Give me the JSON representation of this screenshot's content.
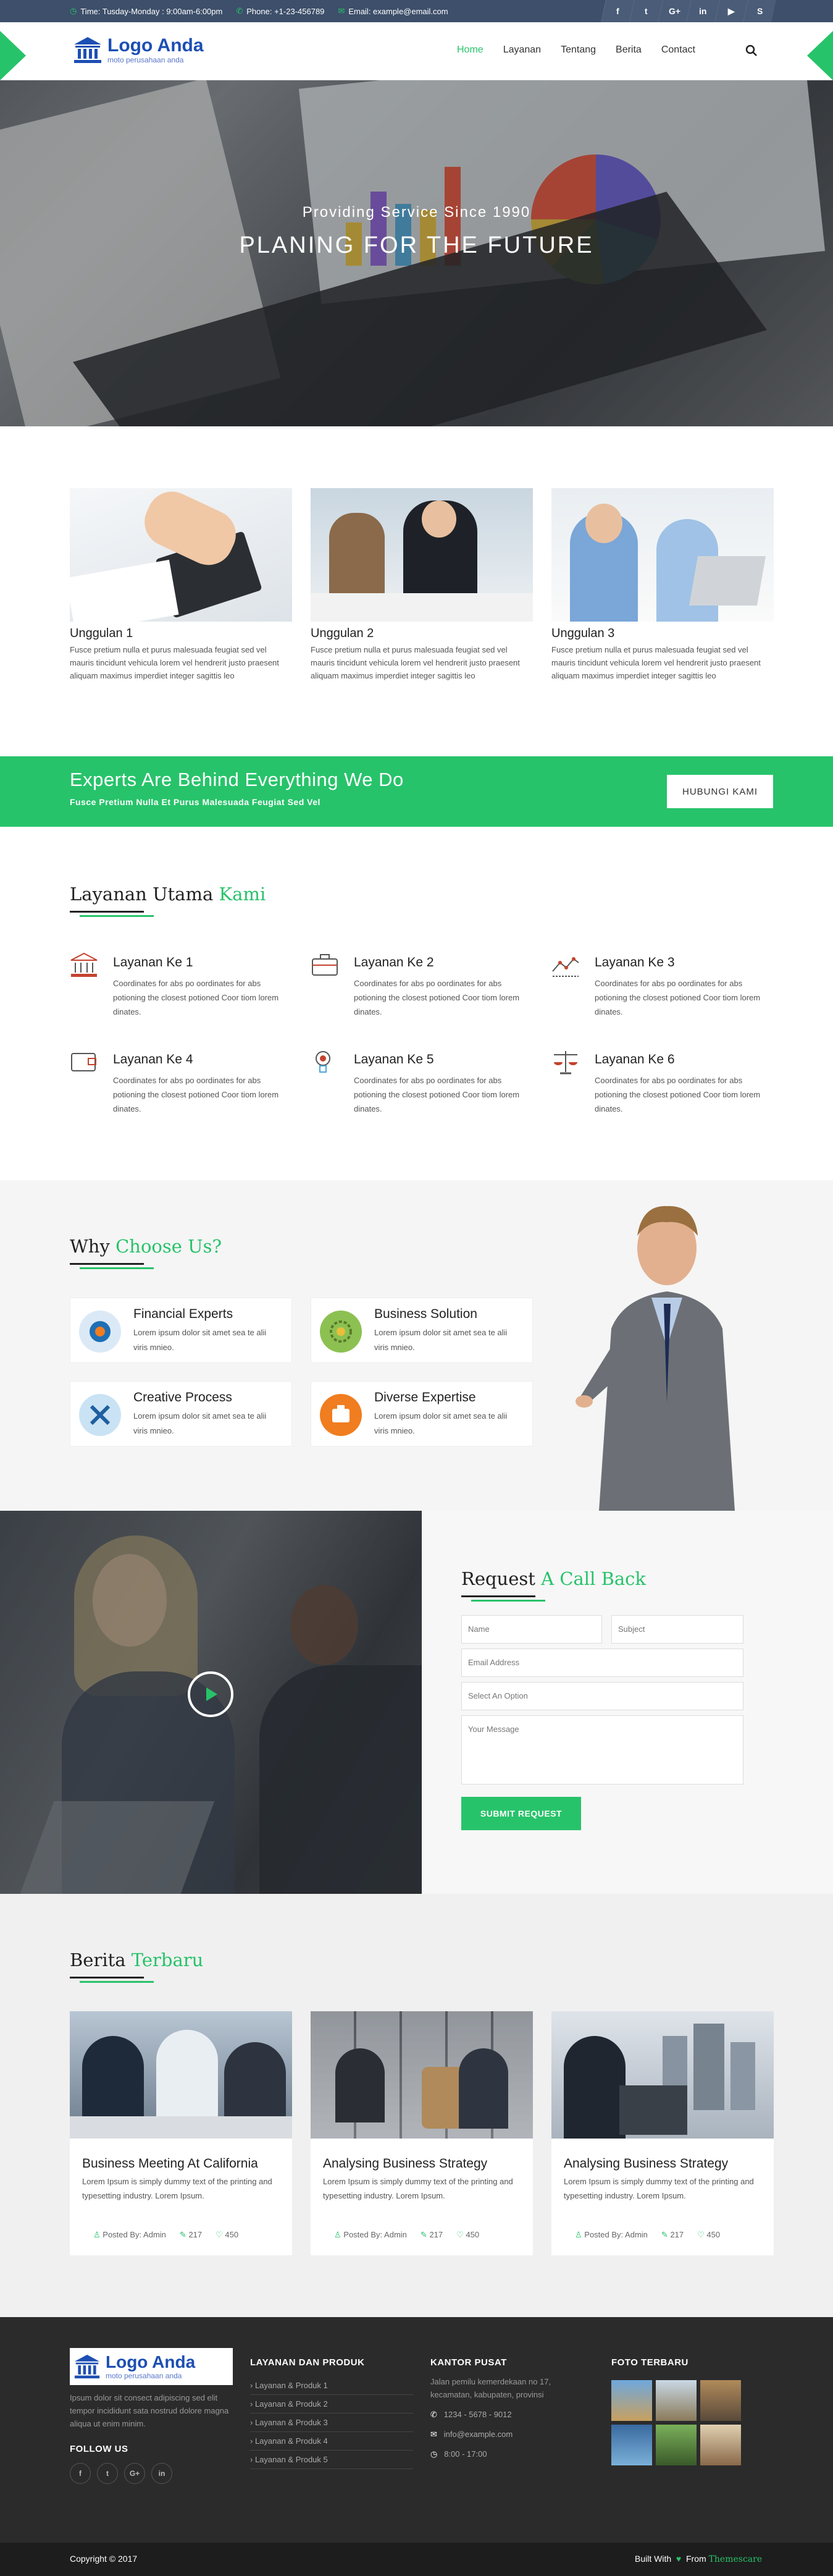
{
  "topbar": {
    "time": "Time: Tusday-Monday : 9:00am-6:00pm",
    "phone": "Phone: +1-23-456789",
    "email": "Email: example@email.com",
    "social": [
      "f",
      "t",
      "G+",
      "in",
      "yt",
      "S"
    ]
  },
  "logo": {
    "title": "Logo Anda",
    "subtitle": "moto perusahaan anda"
  },
  "nav": [
    "Home",
    "Layanan",
    "Tentang",
    "Berita",
    "Contact"
  ],
  "hero": {
    "subtitle": "Providing Service Since 1990",
    "title": "PLANING FOR THE FUTURE"
  },
  "features": [
    {
      "title": "Unggulan 1",
      "text": "Fusce pretium nulla et purus malesuada feugiat sed vel mauris tincidunt vehicula lorem vel hendrerit justo praesent aliquam maximus imperdiet integer sagittis leo"
    },
    {
      "title": "Unggulan 2",
      "text": "Fusce pretium nulla et purus malesuada feugiat sed vel mauris tincidunt vehicula lorem vel hendrerit justo praesent aliquam maximus imperdiet integer sagittis leo"
    },
    {
      "title": "Unggulan 3",
      "text": "Fusce pretium nulla et purus malesuada feugiat sed vel mauris tincidunt vehicula lorem vel hendrerit justo praesent aliquam maximus imperdiet integer sagittis leo"
    }
  ],
  "banner": {
    "title": "Experts Are Behind Everything We Do",
    "subtitle": "Fusce Pretium Nulla Et Purus Malesuada Feugiat Sed Vel",
    "button": "HUBUNGI KAMI"
  },
  "services": {
    "heading": "Layanan Utama",
    "heading_accent": "Kami",
    "items": [
      {
        "title": "Layanan Ke 1",
        "text": "Coordinates for abs po oordinates for abs potioning the closest potioned Coor tiom lorem dinates.",
        "icon": "bank-icon"
      },
      {
        "title": "Layanan Ke 2",
        "text": "Coordinates for abs po oordinates for abs potioning the closest potioned Coor tiom lorem dinates.",
        "icon": "briefcase-icon"
      },
      {
        "title": "Layanan Ke 3",
        "text": "Coordinates for abs po oordinates for abs potioning the closest potioned Coor tiom lorem dinates.",
        "icon": "chart-line-icon"
      },
      {
        "title": "Layanan Ke 4",
        "text": "Coordinates for abs po oordinates for abs potioning the closest potioned Coor tiom lorem dinates.",
        "icon": "wallet-icon"
      },
      {
        "title": "Layanan Ke 5",
        "text": "Coordinates for abs po oordinates for abs potioning the closest potioned Coor tiom lorem dinates.",
        "icon": "lightbulb-icon"
      },
      {
        "title": "Layanan Ke 6",
        "text": "Coordinates for abs po oordinates for abs potioning the closest potioned Coor tiom lorem dinates.",
        "icon": "scale-icon"
      }
    ]
  },
  "why": {
    "heading": "Why",
    "heading_accent": "Choose Us?",
    "items": [
      {
        "title": "Financial Experts",
        "text": "Lorem ipsum dolor sit amet sea te alii viris mnieo."
      },
      {
        "title": "Business Solution",
        "text": "Lorem ipsum dolor sit amet sea te alii viris mnieo."
      },
      {
        "title": "Creative Process",
        "text": "Lorem ipsum dolor sit amet sea te alii viris mnieo."
      },
      {
        "title": "Diverse Expertise",
        "text": "Lorem ipsum dolor sit amet sea te alii viris mnieo."
      }
    ],
    "colors": [
      "#1f6fb5",
      "#8cc152",
      "#4da6d8",
      "#f07d1f"
    ]
  },
  "callback": {
    "heading": "Request",
    "heading_accent": "A Call Back",
    "name_placeholder": "Name",
    "subject_placeholder": "Subject",
    "email_placeholder": "Email Address",
    "select_placeholder": "Select An Option",
    "message_placeholder": "Your Message",
    "submit": "SUBMIT REQUEST"
  },
  "news": {
    "heading": "Berita",
    "heading_accent": "Terbaru",
    "items": [
      {
        "title": "Business Meeting At California",
        "text": "Lorem Ipsum is simply dummy text of the printing and typesetting industry. Lorem Ipsum.",
        "author": "Posted By: Admin",
        "comments": "217",
        "likes": "450"
      },
      {
        "title": "Analysing Business Strategy",
        "text": "Lorem Ipsum is simply dummy text of the printing and typesetting industry. Lorem Ipsum.",
        "author": "Posted By: Admin",
        "comments": "217",
        "likes": "450"
      },
      {
        "title": "Analysing Business Strategy",
        "text": "Lorem Ipsum is simply dummy text of the printing and typesetting industry. Lorem Ipsum.",
        "author": "Posted By: Admin",
        "comments": "217",
        "likes": "450"
      }
    ]
  },
  "footer": {
    "about": "Ipsum dolor sit consect adipiscing sed elit tempor incididunt sata nostrud dolore magna aliqua ut enim minim.",
    "follow": "FOLLOW US",
    "social": [
      "f",
      "t",
      "G+",
      "in"
    ],
    "products_title": "LAYANAN DAN PRODUK",
    "products": [
      "› Layanan & Produk 1",
      "› Layanan & Produk 2",
      "› Layanan & Produk 3",
      "› Layanan & Produk 4",
      "› Layanan & Produk 5"
    ],
    "office_title": "KANTOR PUSAT",
    "address": "Jalan pemilu kemerdekaan no 17, kecamatan, kabupaten, provinsi",
    "phone": "1234 - 5678 - 9012",
    "email": "info@example.com",
    "hours": "8:00 - 17:00",
    "photos_title": "FOTO TERBARU"
  },
  "bottom": {
    "copyright": "Copyright © 2017",
    "built": "Built With",
    "from": "From",
    "brand": "Themescare"
  },
  "accent": "#27c36a"
}
